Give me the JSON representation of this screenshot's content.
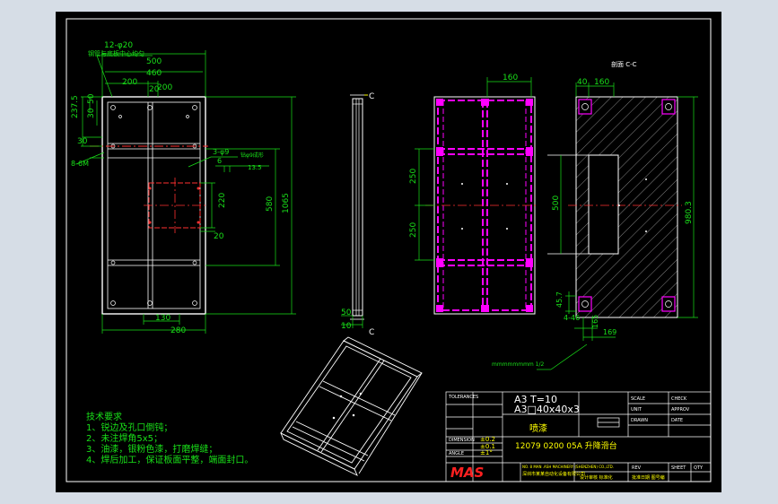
{
  "colors": {
    "background": "#000000",
    "geometry": "#ffffff",
    "dimension": "#19e019",
    "section": "#ff00ff",
    "centerline": "#ff2a2a",
    "highlight": "#ffff00",
    "hatch": "#c8c8c8",
    "viewport_bg": "#d6dde6",
    "brand": "#ff2020"
  },
  "front_view": {
    "dims": {
      "top_note": "12-φ20",
      "top_note2": "钢管与底板中心均匀",
      "w500": "500",
      "w460": "460",
      "w200": "200",
      "w20": "20",
      "h237": "237.5",
      "h30": "30",
      "h50": "50",
      "h30b": "30",
      "side_label": "8-6M",
      "hole_note": "3-φ9",
      "hole_note2": "6",
      "hole_note3": "钻φ9成形",
      "hole_note4": "13.5",
      "h220": "220",
      "h20": "20",
      "h580": "580",
      "h1065": "1065",
      "b130": "130",
      "b280": "280"
    }
  },
  "side_view": {
    "section_marker_top": "C",
    "section_marker_bottom": "C",
    "dim_50": "50",
    "dim_10": "10"
  },
  "section_view": {
    "title": "剖面 C-C",
    "dim_160": "160",
    "dim_250a": "250",
    "dim_250b": "250",
    "dim_500": "500"
  },
  "plate_view": {
    "dim_40": "40",
    "dim_160": "160",
    "dim_980": "980.3",
    "dim_457": "45.7",
    "dim_446": "4-46",
    "dim_169": "169",
    "dim_165": "165"
  },
  "weld_note": "mmmmmmmm  1/2",
  "tech_requirements": {
    "title": "技术要求",
    "items": [
      "1、锐边及孔口倒钝；",
      "2、未注焊角5x5；",
      "3、油漆，银粉色漆，打磨焊缝；",
      "4、焊后加工，保证板面平整，端面封口。"
    ]
  },
  "title_block": {
    "material_line1": "A3  T=10",
    "material_line2": "A3□40x40x3",
    "finish": "喷漆",
    "drawing_no": "12079  0200  05A  升降滑台",
    "tolerance_1": "±0.2",
    "tolerance_2": "±0.1",
    "tolerance_3": "±1°",
    "company_en": "NO. 8 MAN  .ASH  MACHINERY (SHENZHEN) CO.,LTD.",
    "company_cn": "深圳市某某自动化设备有限公司",
    "brand": "MAS",
    "footer_1": "设计审核  标准化",
    "footer_2": "批准日期  图号编",
    "small_labels": [
      "TOLERANCES",
      "DIMENSION",
      "ANGLE",
      "SCALE",
      "UNIT",
      "DRAWN",
      "CHECK",
      "APPROV",
      "DATE",
      "REV",
      "SHEET",
      "QTY"
    ]
  }
}
